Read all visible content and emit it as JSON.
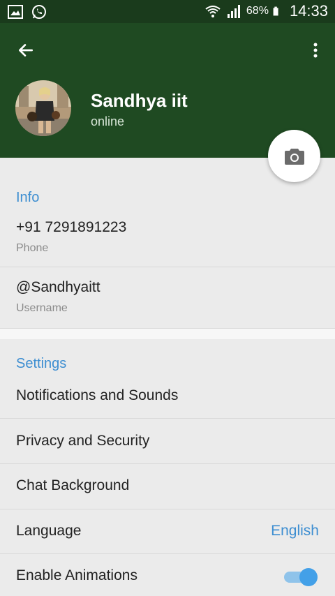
{
  "status_bar": {
    "battery_percent": "68%",
    "time": "14:33"
  },
  "header": {
    "name": "Sandhya iit",
    "status": "online"
  },
  "info": {
    "title": "Info",
    "phone": "+91 7291891223",
    "phone_label": "Phone",
    "username": "@Sandhyaitt",
    "username_label": "Username"
  },
  "settings": {
    "title": "Settings",
    "items": [
      {
        "label": "Notifications and Sounds"
      },
      {
        "label": "Privacy and Security"
      },
      {
        "label": "Chat Background"
      },
      {
        "label": "Language",
        "value": "English"
      },
      {
        "label": "Enable Animations",
        "toggle_on": true
      }
    ]
  },
  "colors": {
    "header_bg": "#1f4a22",
    "accent": "#3d8ed1",
    "toggle_on": "#43a0e8"
  },
  "icons": [
    "gallery-icon",
    "whatsapp-icon",
    "wifi-icon",
    "signal-icon",
    "battery-icon",
    "back-arrow-icon",
    "more-vert-icon",
    "camera-icon"
  ]
}
